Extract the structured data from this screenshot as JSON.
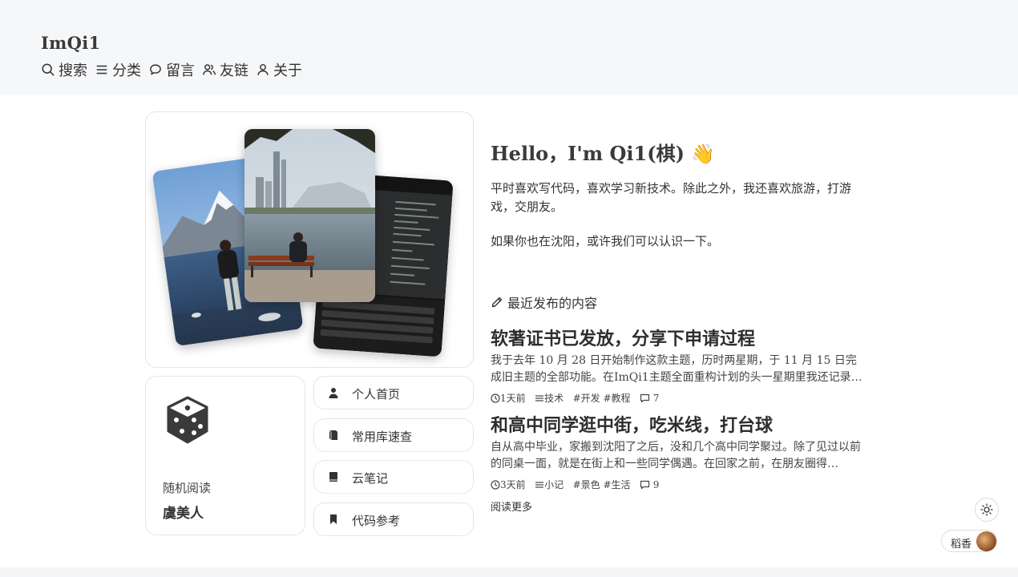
{
  "site": {
    "title": "ImQi1"
  },
  "nav": {
    "search": "搜索",
    "category": "分类",
    "message": "留言",
    "friends": "友链",
    "about": "关于"
  },
  "random": {
    "label": "随机阅读",
    "title": "虞美人"
  },
  "links": {
    "home": "个人首页",
    "libs": "常用库速查",
    "notes": "云笔记",
    "code": "代码参考"
  },
  "intro": {
    "title": "Hello，I'm Qi1(棋) 👋",
    "p1": "平时喜欢写代码，喜欢学习新技术。除此之外，我还喜欢旅游，打游戏，交朋友。",
    "p2": "如果你也在沈阳，或许我们可以认识一下。"
  },
  "recent": {
    "heading": "最近发布的内容",
    "posts": [
      {
        "title": "软著证书已发放，分享下申请过程",
        "excerpt": "我于去年 10 月 28 日开始制作这款主题，历时两星期，于 11 月 15 日完成旧主题的全部功能。在ImQi1主题全面重构计划的头一星期里我还记录…",
        "time": "1天前",
        "category": "技术",
        "tags": [
          "#开发",
          "#教程"
        ],
        "comments": "7"
      },
      {
        "title": "和高中同学逛中街，吃米线，打台球",
        "excerpt": "自从高中毕业，家搬到沈阳了之后，没和几个高中同学聚过。除了见过以前的同桌一面，就是在街上和一些同学偶遇。在回家之前，在朋友圈得…",
        "time": "3天前",
        "category": "小记",
        "tags": [
          "#景色",
          "#生活"
        ],
        "comments": "9"
      }
    ],
    "read_more": "阅读更多"
  },
  "widget": {
    "label": "稻香"
  }
}
